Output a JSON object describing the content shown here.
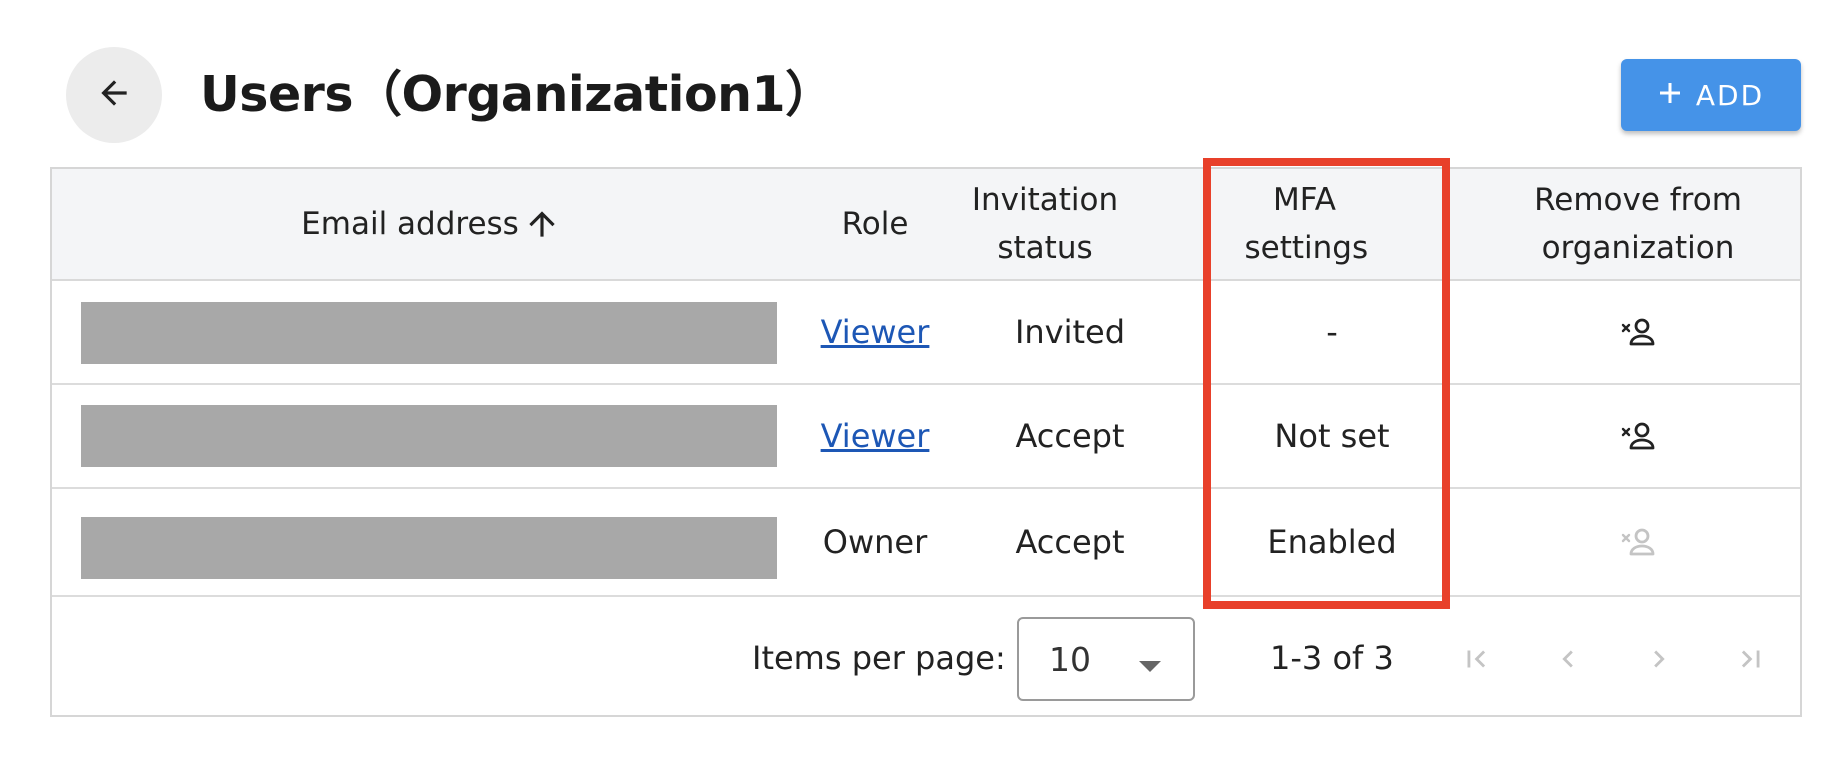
{
  "header": {
    "title": "Users（Organization1）",
    "add_button_label": "ADD"
  },
  "table": {
    "columns": [
      {
        "key": "email",
        "label": "Email address",
        "sorted": "ascending"
      },
      {
        "key": "role",
        "label": "Role"
      },
      {
        "key": "invitation",
        "label": "Invitation status"
      },
      {
        "key": "mfa",
        "label": "MFA settings"
      },
      {
        "key": "remove",
        "label": "Remove from organization"
      }
    ],
    "rows": [
      {
        "email": "",
        "role": "Viewer",
        "role_is_link": true,
        "invitation": "Invited",
        "mfa": "-",
        "remove_enabled": true
      },
      {
        "email": "",
        "role": "Viewer",
        "role_is_link": true,
        "invitation": "Accept",
        "mfa": "Not set",
        "remove_enabled": true
      },
      {
        "email": "",
        "role": "Owner",
        "role_is_link": false,
        "invitation": "Accept",
        "mfa": "Enabled",
        "remove_enabled": false
      }
    ]
  },
  "pagination": {
    "items_per_page_label": "Items per page:",
    "items_per_page": "10",
    "range": "1-3 of 3"
  },
  "colors": {
    "accent": "#4593e8",
    "link": "#1d57b5",
    "highlight_frame": "#e8402a",
    "header_bg": "#f4f5f7",
    "redaction": "#a8a8a8"
  },
  "icons": [
    "arrow-left-icon",
    "plus-icon",
    "arrow-up-icon",
    "remove-person-icon",
    "first-page-icon",
    "chevron-left-icon",
    "chevron-right-icon",
    "last-page-icon",
    "caret-down-icon"
  ]
}
